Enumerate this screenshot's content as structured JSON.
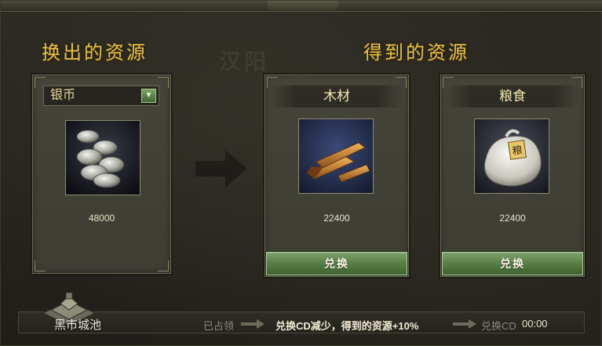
{
  "left_section": {
    "title": "换出的资源",
    "selected_resource": "银币",
    "amount": "48000"
  },
  "right_section": {
    "title": "得到的资源",
    "watermark": "汉阳",
    "cards": [
      {
        "name": "木材",
        "amount": "22400",
        "button": "兑换"
      },
      {
        "name": "粮食",
        "amount": "22400",
        "button": "兑换"
      }
    ]
  },
  "footer": {
    "city_name": "黑市城池",
    "occupied_label": "已占领",
    "bonus_text": "兑换CD减少，得到的资源+10%",
    "cooldown_label": "兑换CD",
    "cooldown_value": "00:00"
  },
  "colors": {
    "title_gold": "#e6c04a",
    "button_green": "#5b8049",
    "panel_bg": "#3e3d34"
  }
}
